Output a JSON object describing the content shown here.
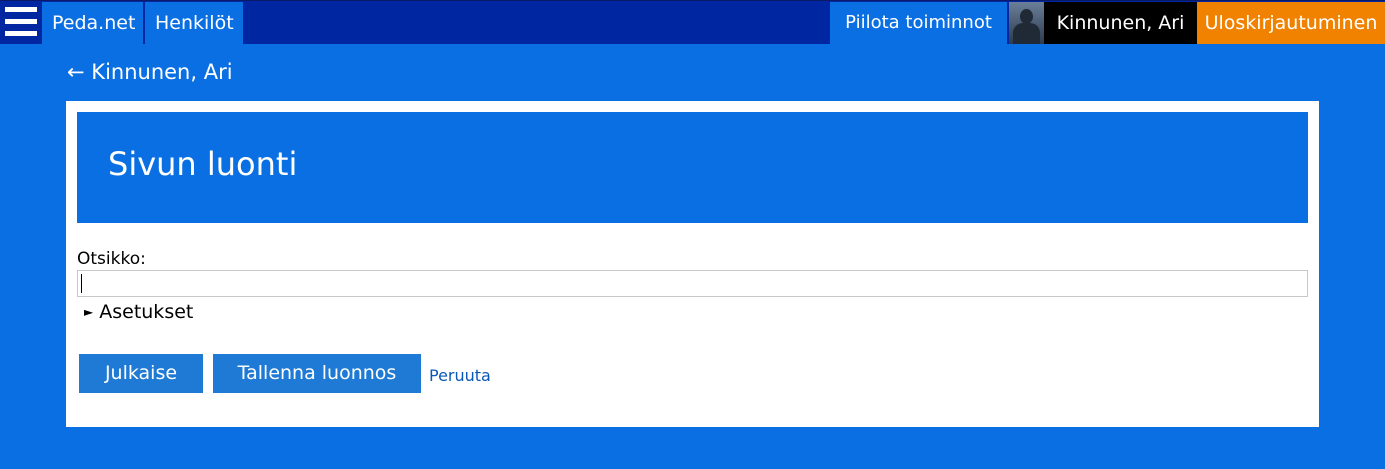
{
  "topbar": {
    "menu_icon": "hamburger-menu-icon",
    "nav": [
      {
        "label": "Peda.net"
      },
      {
        "label": "Henkilöt"
      }
    ],
    "hide_actions_label": "Piilota toiminnot",
    "user": {
      "avatar_icon": "user-avatar-icon",
      "name": "Kinnunen, Ari"
    },
    "logout_label": "Uloskirjautuminen",
    "colors": {
      "bar": "#0026a1",
      "nav_item": "#0a6fe3",
      "user_bg": "#000000",
      "logout_bg": "#f08200"
    }
  },
  "back_link": {
    "arrow": "←",
    "label": "Kinnunen, Ari"
  },
  "page": {
    "title": "Sivun luonti",
    "form": {
      "title_label": "Otsikko:",
      "title_value": "",
      "title_placeholder": "",
      "settings_arrow": "►",
      "settings_label": "Asetukset"
    },
    "actions": {
      "publish_label": "Julkaise",
      "save_draft_label": "Tallenna luonnos",
      "cancel_label": "Peruuta"
    }
  },
  "colors": {
    "background": "#0a6fe3",
    "card": "#ffffff",
    "button": "#1e7ad4",
    "link": "#0b57b8"
  }
}
